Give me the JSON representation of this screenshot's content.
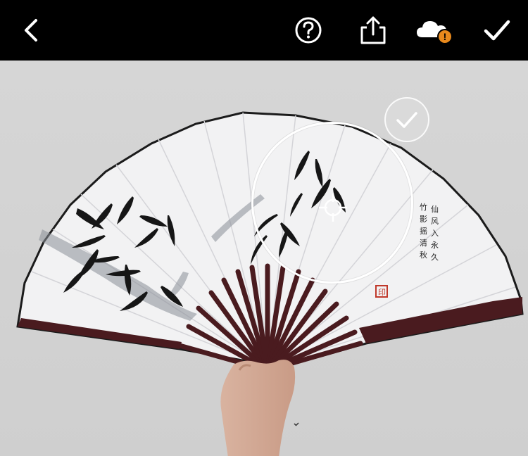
{
  "toolbar": {
    "buttons": [
      {
        "name": "back-button",
        "icon": "chevron-left-icon"
      },
      {
        "name": "help-button",
        "icon": "question-circle-icon"
      },
      {
        "name": "share-button",
        "icon": "share-icon"
      },
      {
        "name": "cloud-sync-button",
        "icon": "cloud-warning-icon",
        "badge": "!"
      },
      {
        "name": "done-button",
        "icon": "checkmark-icon"
      }
    ]
  },
  "colors": {
    "toolbar_bg": "#000000",
    "icon": "#ffffff",
    "warning_badge": "#e8891c",
    "wall": "#d9d9d9",
    "fan_paper": "#f2f2f3",
    "fan_ribs": "#4a1b1f",
    "ink": "#1a1a1a",
    "seal": "#c0392b"
  },
  "image": {
    "subject": "hand-held folding fan with ink bamboo painting",
    "seal_text": "印",
    "calligraphy": [
      "仙",
      "风",
      "入",
      "永",
      "久",
      "竹",
      "影",
      "摇",
      "清",
      "秋"
    ]
  },
  "overlay": {
    "loupe": "magnifier-loupe",
    "crosshair": "crosshair-icon",
    "confirm_point": "checkmark-icon"
  }
}
